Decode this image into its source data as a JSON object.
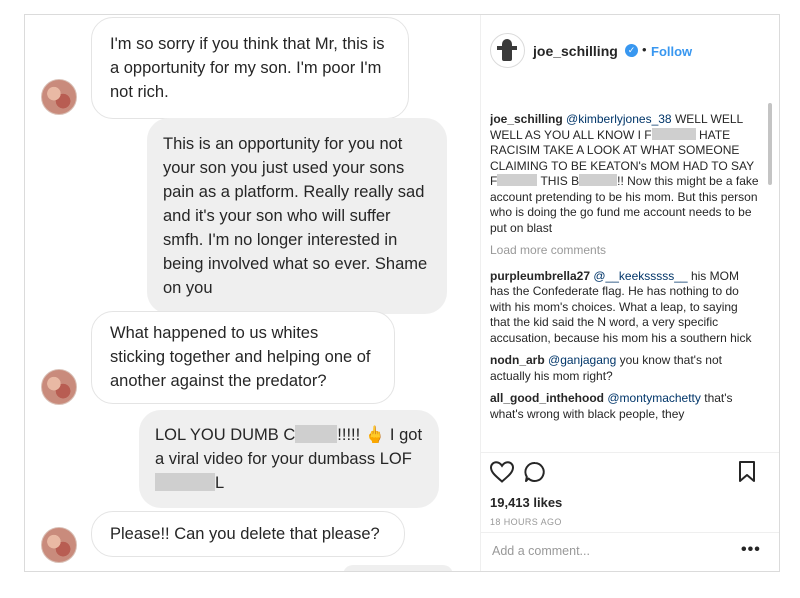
{
  "dm": {
    "messages": [
      {
        "side": "in",
        "text": "I'm so sorry if you think that Mr, this is a opportunity for my son. I'm poor I'm not rich."
      },
      {
        "side": "out",
        "text": "This is an opportunity for you not your son you just used your sons pain as a platform. Really really sad and it's your son who will suffer smfh.  I'm no longer interested in being involved what so ever. Shame on you"
      },
      {
        "side": "in",
        "text": "What happened to us whites sticking together and helping one of another against the predator?"
      },
      {
        "side": "out",
        "text_a": "LOL YOU DUMB C",
        "text_b": "!!!!! 🖕 I got a viral video for your dumbass",
        "text_c": "LOF",
        "text_d": "L"
      },
      {
        "side": "in",
        "text": "Please!! Can you delete that please?"
      }
    ]
  },
  "post": {
    "username": "joe_schilling",
    "dot": "•",
    "follow_label": "Follow",
    "comments": [
      {
        "user": "joe_schilling",
        "mention": "@kimberlyjones_38",
        "text_a": "WELL WELL WELL AS YOU ALL KNOW I F",
        "text_b": "HATE RACISIM TAKE A LOOK AT WHAT SOMEONE CLAIMING TO BE KEATON's MOM HAD TO SAY F",
        "text_c": "THIS B",
        "text_d": "!! Now this might be a fake account pretending to be his mom. But this person who is doing the go fund me account needs to be put on blast"
      },
      {
        "user": "purpleumbrella27",
        "mention": "@__keeksssss__",
        "text": "his MOM has the Confederate flag. He has nothing to do with his mom's choices. What a leap, to saying that the kid said the N word, a very specific accusation, because his mom his a southern hick"
      },
      {
        "user": "nodn_arb",
        "mention": "@ganjagang",
        "text": "you know that's not actually his mom right?"
      },
      {
        "user": "all_good_inthehood",
        "mention": "@montymachetty",
        "text": "that's what's wrong with black people, they"
      }
    ],
    "load_more": "Load more comments",
    "likes": "19,413 likes",
    "time": "18 HOURS AGO",
    "add_comment_placeholder": "Add a comment...",
    "more_options": "•••"
  },
  "icons": [
    "verified-badge-icon",
    "heart-icon",
    "comment-icon",
    "bookmark-icon",
    "more-options-icon"
  ],
  "colors": {
    "link_blue": "#3897f0",
    "bubble_out": "#efefef",
    "border": "#dbdbdb"
  }
}
